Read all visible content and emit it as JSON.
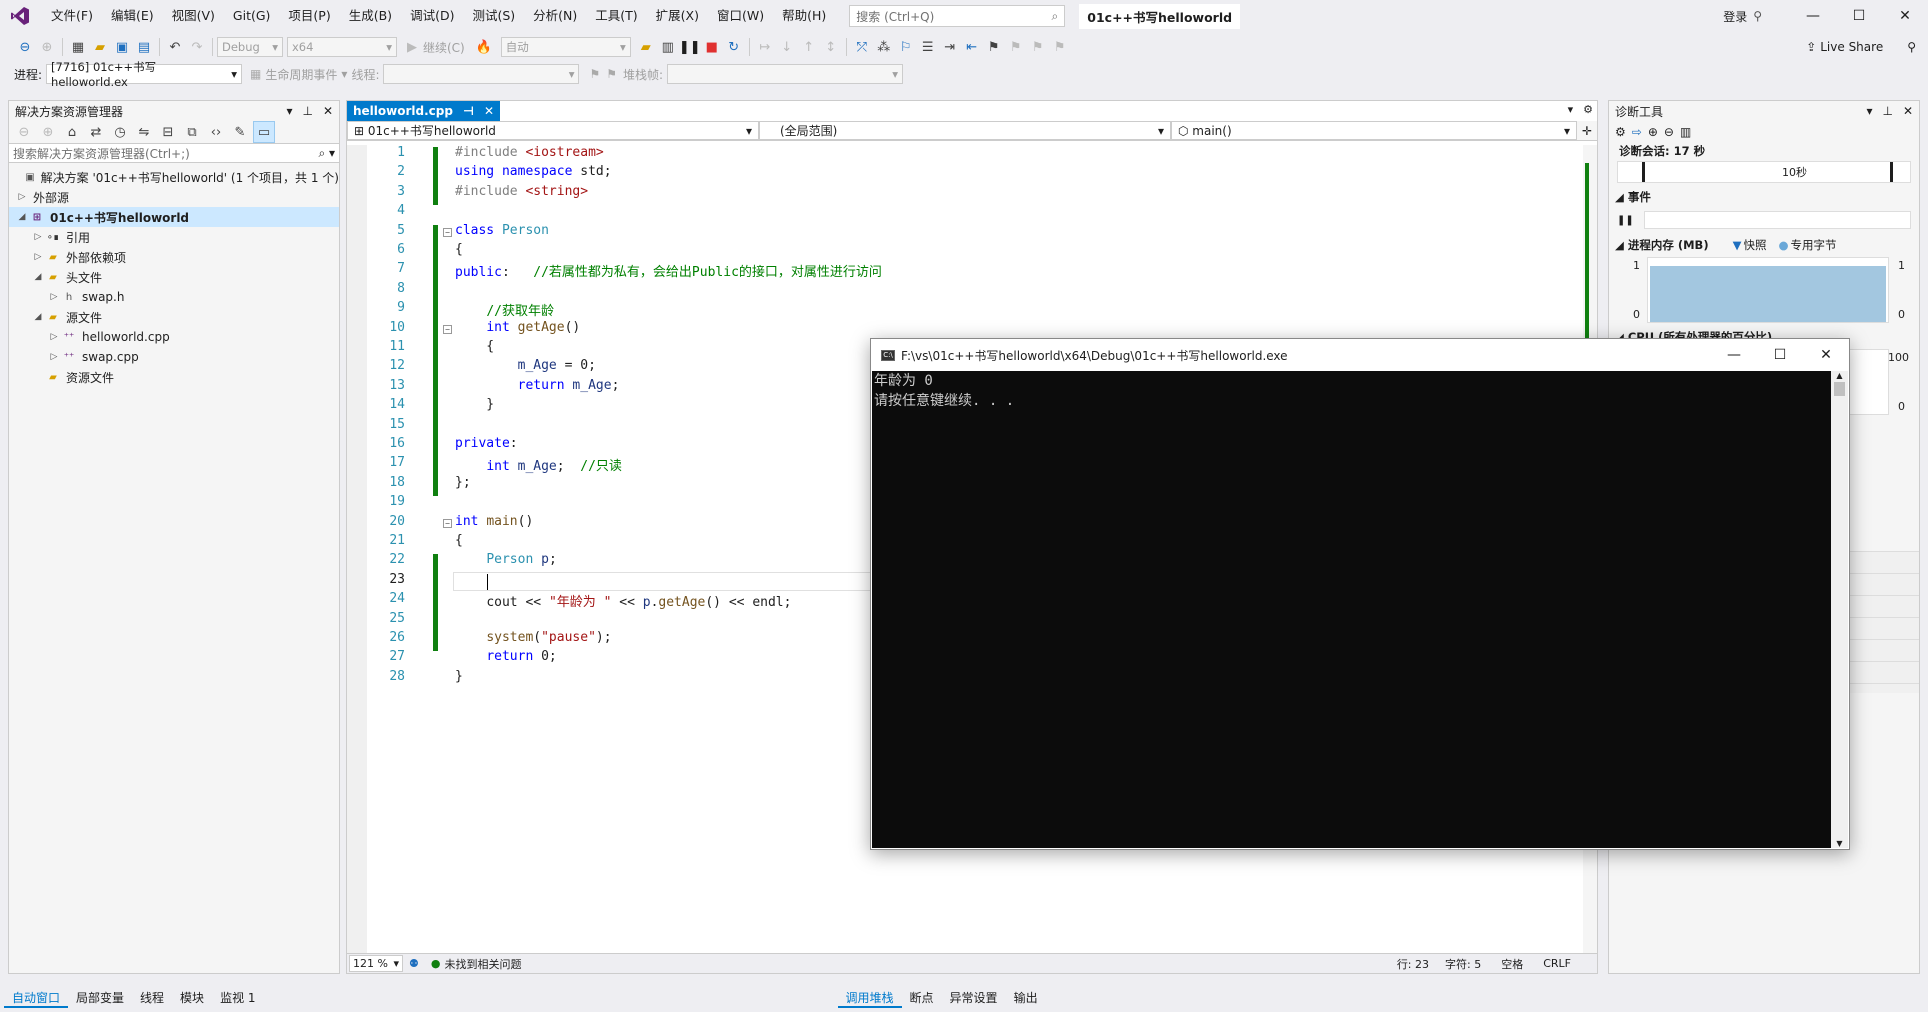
{
  "menu": [
    "文件(F)",
    "编辑(E)",
    "视图(V)",
    "Git(G)",
    "项目(P)",
    "生成(B)",
    "调试(D)",
    "测试(S)",
    "分析(N)",
    "工具(T)",
    "扩展(X)",
    "窗口(W)",
    "帮助(H)"
  ],
  "search": {
    "placeholder": "搜索 (Ctrl+Q)"
  },
  "solution_title": "01c++书写helloworld",
  "window_controls": {
    "login": "登录",
    "minimize": "—",
    "maximize": "☐",
    "close": "✕"
  },
  "toolbar": {
    "config": "Debug",
    "platform": "x64",
    "continue": "继续(C)",
    "auto": "自动",
    "live_share": "Live Share"
  },
  "toolbar2": {
    "process_label": "进程:",
    "process_value": "[7716] 01c++书写helloworld.ex",
    "lifecycle": "生命周期事件",
    "thread_label": "线程:",
    "stack_label": "堆栈帧:"
  },
  "solution_explorer": {
    "title": "解决方案资源管理器",
    "search_placeholder": "搜索解决方案资源管理器(Ctrl+;)",
    "items": [
      {
        "label": "解决方案 '01c++书写helloworld' (1 个项目，共 1 个)",
        "indent": 0,
        "arrow": "",
        "icon": "solution-icon",
        "sel": false,
        "bold": false
      },
      {
        "label": "外部源",
        "indent": 0,
        "arrow": "▷",
        "icon": "",
        "sel": false,
        "bold": false
      },
      {
        "label": "01c++书写helloworld",
        "indent": 0,
        "arrow": "◢",
        "icon": "project-icon",
        "sel": true,
        "bold": true
      },
      {
        "label": "引用",
        "indent": 1,
        "arrow": "▷",
        "icon": "references-icon",
        "sel": false,
        "bold": false
      },
      {
        "label": "外部依赖项",
        "indent": 1,
        "arrow": "▷",
        "icon": "folder-icon",
        "sel": false,
        "bold": false
      },
      {
        "label": "头文件",
        "indent": 1,
        "arrow": "◢",
        "icon": "folder-icon",
        "sel": false,
        "bold": false
      },
      {
        "label": "swap.h",
        "indent": 2,
        "arrow": "▷",
        "icon": "header-file-icon",
        "sel": false,
        "bold": false
      },
      {
        "label": "源文件",
        "indent": 1,
        "arrow": "◢",
        "icon": "folder-icon",
        "sel": false,
        "bold": false
      },
      {
        "label": "helloworld.cpp",
        "indent": 2,
        "arrow": "▷",
        "icon": "cpp-file-icon",
        "sel": false,
        "bold": false
      },
      {
        "label": "swap.cpp",
        "indent": 2,
        "arrow": "▷",
        "icon": "cpp-file-icon",
        "sel": false,
        "bold": false
      },
      {
        "label": "资源文件",
        "indent": 1,
        "arrow": "",
        "icon": "folder-icon",
        "sel": false,
        "bold": false
      }
    ]
  },
  "editor": {
    "tab": "helloworld.cpp",
    "nav_project": "01c++书写helloworld",
    "nav_scope": "(全局范围)",
    "nav_member": "main()",
    "zoom": "121 %",
    "issues": "未找到相关问题",
    "line": "行: 23",
    "char": "字符: 5",
    "spaces": "空格",
    "eol": "CRLF",
    "lines": [
      "#include <iostream>",
      "using namespace std;",
      "#include <string>",
      "",
      "class Person",
      "{",
      "public:   //若属性都为私有，会给出Public的接口，对属性进行访问",
      "",
      "    //获取年龄",
      "    int getAge()",
      "    {",
      "        m_Age = 0;",
      "        return m_Age;",
      "    }",
      "",
      "private:",
      "    int m_Age;  //只读",
      "};",
      "",
      "int main()",
      "{",
      "    Person p;",
      "    ",
      "    cout << \"年龄为 \" << p.getAge() << endl;",
      "",
      "    system(\"pause\");",
      "    return 0;",
      "}"
    ]
  },
  "diagnostics": {
    "title": "诊断工具",
    "session": "诊断会话: 17 秒",
    "timeline_label": "10秒",
    "events": "事件",
    "memory": "进程内存 (MB)",
    "snapshot": "快照",
    "private_bytes": "专用字节",
    "mem_max": "1",
    "mem_min": "0",
    "cpu": "CPU (所有处理器的百分比)",
    "cpu_max": "100",
    "cpu_min": "0"
  },
  "console": {
    "title": "F:\\vs\\01c++书写helloworld\\x64\\Debug\\01c++书写helloworld.exe",
    "lines": [
      "年龄为 0",
      "请按任意键继续. . ."
    ]
  },
  "bottom_left": [
    "自动窗口",
    "局部变量",
    "线程",
    "模块",
    "监视 1"
  ],
  "bottom_right": [
    "调用堆栈",
    "断点",
    "异常设置",
    "输出"
  ]
}
